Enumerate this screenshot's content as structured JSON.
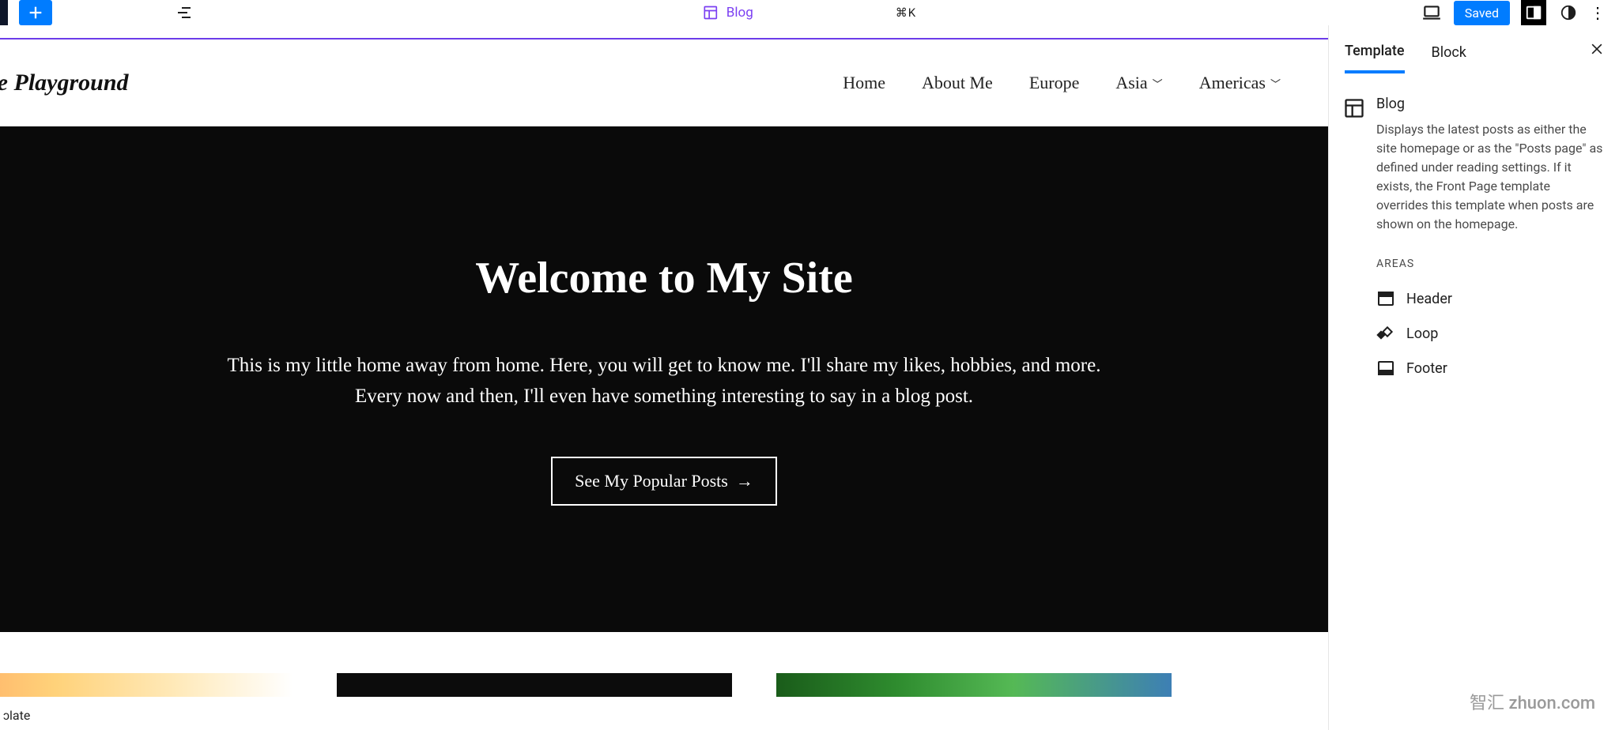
{
  "topbar": {
    "doc_label": "Blog",
    "command_hint": "⌘K",
    "saved_label": "Saved"
  },
  "site": {
    "title": "he Playground",
    "nav": [
      "Home",
      "About Me",
      "Europe",
      "Asia",
      "Americas"
    ]
  },
  "hero": {
    "heading": "Welcome to My Site",
    "body": "This is my little home away from home. Here, you will get to know me. I'll share my likes, hobbies, and more. Every now and then, I'll even have something interesting to say in a blog post.",
    "button": "See My Popular Posts"
  },
  "bottom_label": "ɔlate",
  "inspector": {
    "tabs": {
      "template": "Template",
      "block": "Block"
    },
    "title": "Blog",
    "description": "Displays the latest posts as either the site homepage or as the \"Posts page\" as defined under reading settings. If it exists, the Front Page template overrides this template when posts are shown on the homepage.",
    "areas_label": "AREAS",
    "areas": [
      "Header",
      "Loop",
      "Footer"
    ]
  },
  "watermark": {
    "zh": "智汇",
    "en": "zhuon.com"
  }
}
